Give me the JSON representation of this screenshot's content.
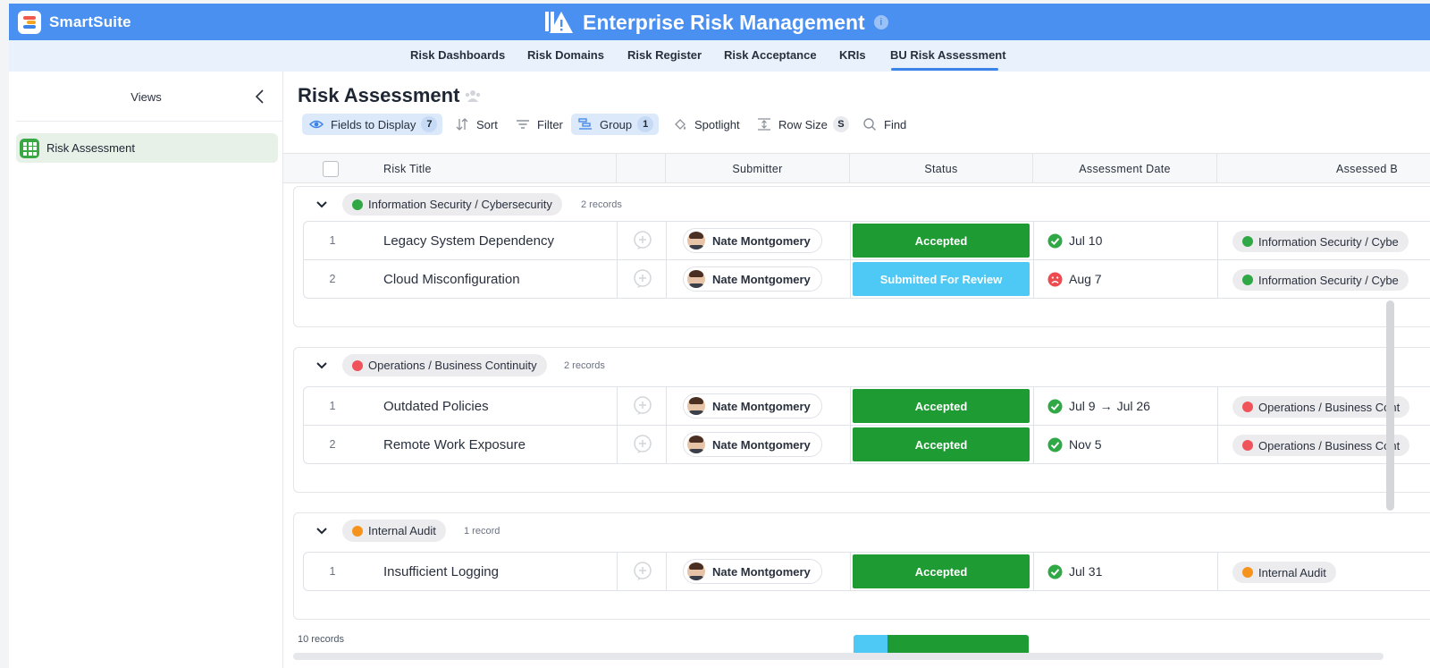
{
  "brand": {
    "name": "SmartSuite"
  },
  "app": {
    "title": "Enterprise Risk Management"
  },
  "nav": {
    "tabs": [
      {
        "label": "Risk Dashboards"
      },
      {
        "label": "Risk Domains"
      },
      {
        "label": "Risk Register"
      },
      {
        "label": "Risk Acceptance"
      },
      {
        "label": "KRIs"
      },
      {
        "label": "BU Risk Assessment"
      }
    ],
    "active_tab": "BU Risk Assessment"
  },
  "sidebar": {
    "title": "Views",
    "items": [
      {
        "label": "Risk Assessment",
        "icon": "grid-icon",
        "active": true
      }
    ]
  },
  "main": {
    "title": "Risk Assessment",
    "toolbar": {
      "fields": {
        "label": "Fields to Display",
        "badge": "7"
      },
      "sort": {
        "label": "Sort"
      },
      "filter": {
        "label": "Filter"
      },
      "group": {
        "label": "Group",
        "badge": "1"
      },
      "spotlight": {
        "label": "Spotlight"
      },
      "row_size": {
        "label": "Row Size",
        "badge": "S"
      },
      "find": {
        "label": "Find"
      }
    },
    "columns": {
      "risk_title": "Risk Title",
      "submitter": "Submitter",
      "status": "Status",
      "assessment_date": "Assessment Date",
      "assessed_by": "Assessed B"
    },
    "groups": [
      {
        "name": "Information Security / Cybersecurity",
        "color": "#2fa845",
        "count": "2 records",
        "rows": [
          {
            "num": "1",
            "title": "Legacy System Dependency",
            "submitter": "Nate Montgomery",
            "status": "Accepted",
            "status_color": "#1e9b33",
            "date_icon": "check-circle-icon",
            "date": "Jul 10",
            "date_end": "",
            "bu": "Information Security / Cybe"
          },
          {
            "num": "2",
            "title": "Cloud Misconfiguration",
            "submitter": "Nate Montgomery",
            "status": "Submitted For Review",
            "status_color": "#4ec8f4",
            "date_icon": "sad-face-icon",
            "date": "Aug 7",
            "date_end": "",
            "bu": "Information Security / Cybe"
          }
        ]
      },
      {
        "name": "Operations / Business Continuity",
        "color": "#f0535a",
        "count": "2 records",
        "rows": [
          {
            "num": "1",
            "title": "Outdated Policies",
            "submitter": "Nate Montgomery",
            "status": "Accepted",
            "status_color": "#1e9b33",
            "date_icon": "check-circle-icon",
            "date": "Jul 9",
            "date_end": "Jul 26",
            "bu": "Operations / Business Cont"
          },
          {
            "num": "2",
            "title": "Remote Work Exposure",
            "submitter": "Nate Montgomery",
            "status": "Accepted",
            "status_color": "#1e9b33",
            "date_icon": "check-circle-icon",
            "date": "Nov 5",
            "date_end": "",
            "bu": "Operations / Business Cont"
          }
        ]
      },
      {
        "name": "Internal Audit",
        "color": "#f5931d",
        "count": "1 record",
        "rows": [
          {
            "num": "1",
            "title": "Insufficient Logging",
            "submitter": "Nate Montgomery",
            "status": "Accepted",
            "status_color": "#1e9b33",
            "date_icon": "check-circle-icon",
            "date": "Jul 31",
            "date_end": "",
            "bu": "Internal Audit"
          }
        ]
      }
    ],
    "footer": {
      "records": "10 records"
    }
  },
  "colors": {
    "header": "#4a90f0",
    "nav_bg": "#e9f1fc",
    "accepted": "#1e9b33",
    "review": "#4ec8f4"
  }
}
